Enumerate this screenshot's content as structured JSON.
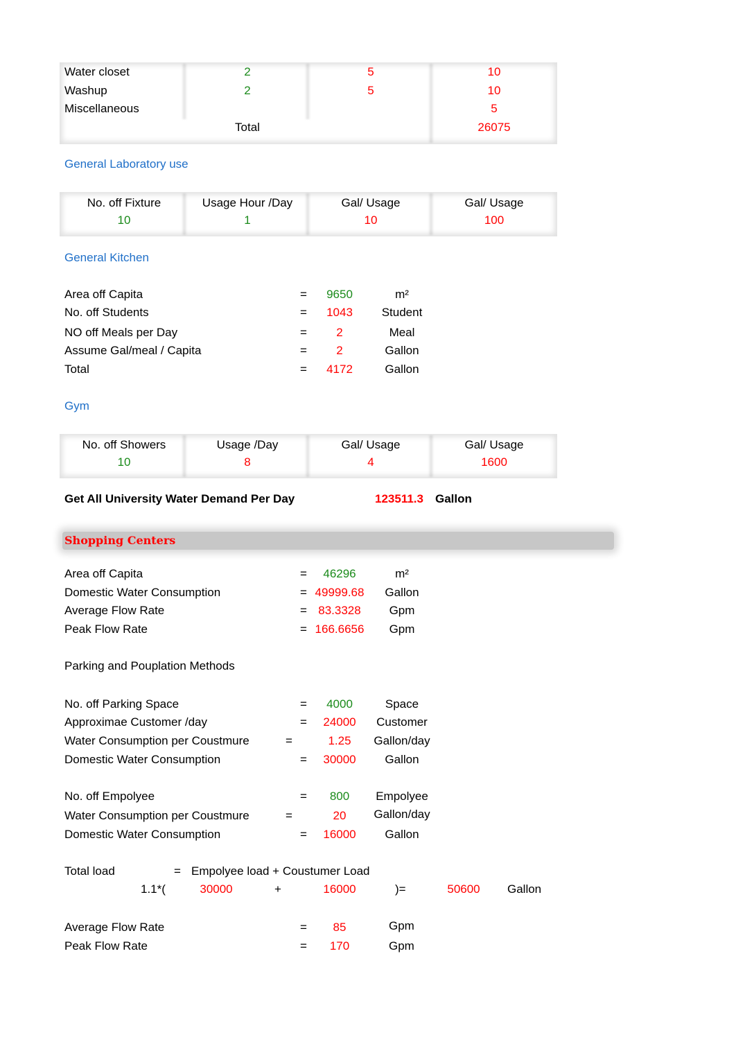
{
  "fixture_table": {
    "rows": [
      {
        "name": "Water closet",
        "fixtures": "2",
        "usage": "5",
        "gal": "10"
      },
      {
        "name": "Washup",
        "fixtures": "2",
        "usage": "5",
        "gal": "10"
      },
      {
        "name": "Miscellaneous",
        "fixtures": "",
        "usage": "",
        "gal": "5"
      }
    ],
    "total_label": "Total",
    "total_value": "26075"
  },
  "laboratory": {
    "title": "General Laboratory use",
    "headers": [
      "No. off Fixture",
      "Usage Hour /Day",
      "Gal/ Usage",
      "Gal/ Usage"
    ],
    "values": [
      "10",
      "1",
      "10",
      "100"
    ]
  },
  "kitchen": {
    "title": "General Kitchen",
    "rows": [
      {
        "label": "Area off Capita",
        "eq": "=",
        "value": "9650",
        "unit": "m²"
      },
      {
        "label": "No. off Students",
        "eq": "=",
        "value": "1043",
        "unit": "Student"
      },
      {
        "label": "NO off Meals per Day",
        "eq": "=",
        "value": "2",
        "unit": "Meal"
      },
      {
        "label": "Assume  Gal/meal / Capita",
        "eq": "=",
        "value": "2",
        "unit": "Gallon"
      },
      {
        "label": "Total",
        "eq": "=",
        "value": "4172",
        "unit": "Gallon"
      }
    ]
  },
  "gym": {
    "title": "Gym",
    "headers": [
      "No. off Showers",
      "Usage /Day",
      "Gal/ Usage",
      "Gal/ Usage"
    ],
    "values": [
      "10",
      "8",
      "4",
      "1600"
    ]
  },
  "university_total": {
    "label": "Get All University Water Demand Per Day",
    "value": "123511.3",
    "unit": "Gallon"
  },
  "shopping": {
    "title": "Shopping Centers",
    "rows": [
      {
        "label": "Area off Capita",
        "eq": "=",
        "value": "46296",
        "unit": "m²"
      },
      {
        "label": "Domestic Water Consumption",
        "eq": "=",
        "value": "49999.68",
        "unit": "Gallon"
      },
      {
        "label": "Average Flow Rate",
        "eq": "=",
        "value": "83.3328",
        "unit": "Gpm"
      },
      {
        "label": "Peak Flow Rate",
        "eq": "=",
        "value": "166.6656",
        "unit": "Gpm"
      }
    ],
    "method_title": "Parking and Pouplation Methods",
    "parking_rows": [
      {
        "label": "No. off Parking Space",
        "eq": "=",
        "value": "4000",
        "unit": "Space"
      },
      {
        "label": "Approximae Customer /day",
        "eq": "=",
        "value": "24000",
        "unit": "Customer"
      },
      {
        "label": "Water Consumption per Coustmure",
        "eq": "=",
        "value": "1.25",
        "unit": "Gallon/day"
      },
      {
        "label": "Domestic Water Consumption",
        "eq": "=",
        "value": "30000",
        "unit": "Gallon"
      }
    ],
    "employee_rows": [
      {
        "label": "No. off Empolyee",
        "eq": "=",
        "value": "800",
        "unit": "Empolyee"
      },
      {
        "label": "Water Consumption per Coustmure",
        "eq": "=",
        "value": "20",
        "unit": "Gallon/day"
      },
      {
        "label": "Domestic Water Consumption",
        "eq": "=",
        "value": "16000",
        "unit": "Gallon"
      }
    ],
    "total_load": {
      "label": "Total load",
      "eq": "=",
      "formula": "Empolyee load + Coustumer Load",
      "factor": "1.1*(",
      "a": "30000",
      "plus": "+",
      "b": "16000",
      "close": ")=",
      "result": "50600",
      "unit": "Gallon"
    },
    "flow_rows": [
      {
        "label": "Average Flow Rate",
        "eq": "=",
        "value": "85",
        "unit": "Gpm"
      },
      {
        "label": "Peak Flow Rate",
        "eq": "=",
        "value": "170",
        "unit": "Gpm"
      }
    ]
  }
}
